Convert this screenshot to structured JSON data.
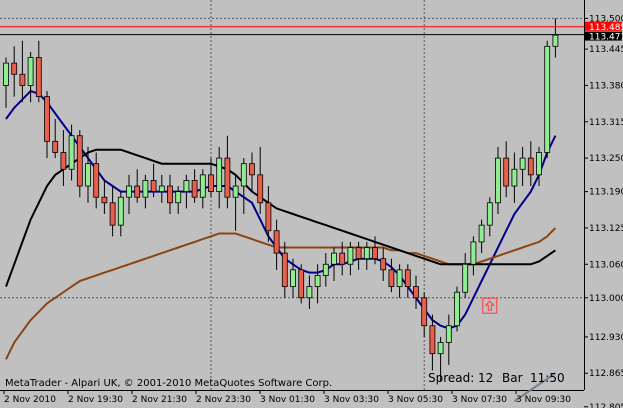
{
  "window": {
    "watermark": "MetaTrader - Alpari UK, © 2001-2010 MetaQuotes Software Corp.",
    "spread_label": "Spread:",
    "spread_value": "12",
    "bar_label": "Bar",
    "bar_timer": "11:50"
  },
  "colors": {
    "background": "#c0c0c0",
    "bull_candle": "#90ee90",
    "bear_candle": "#e8604c",
    "candle_outline": "#000000",
    "ma_fast": "#00008b",
    "ma_medium": "#8b4513",
    "ma_slow": "#000000",
    "ma_far": "#708090",
    "ask_line": "#ff0000",
    "bid_line": "#000000",
    "signal_arrow": "#ff3b3b"
  },
  "chart_data": {
    "type": "candlestick",
    "symbol_timeframe": "",
    "ylim": [
      112.835,
      113.515
    ],
    "x_ticks": [
      "2 Nov 2010",
      "2 Nov 19:30",
      "2 Nov 21:30",
      "2 Nov 23:30",
      "3 Nov 01:30",
      "3 Nov 03:30",
      "3 Nov 05:30",
      "3 Nov 07:30",
      "3 Nov 09:30"
    ],
    "y_ticks": [
      "113.500",
      "113.471",
      "113.445",
      "113.380",
      "113.315",
      "113.250",
      "113.190",
      "113.125",
      "113.060",
      "113.000",
      "112.930",
      "112.865",
      "112.805"
    ],
    "current_price_labels": {
      "ask": "113.485",
      "bid": "113.471"
    },
    "ask_price": 113.485,
    "bid_price": 113.471,
    "high_level": 113.5,
    "horizontal_level": 113.0,
    "vertical_lines_at_index": [
      25,
      51
    ],
    "candles": [
      {
        "o": 113.38,
        "h": 113.43,
        "l": 113.34,
        "c": 113.42
      },
      {
        "o": 113.42,
        "h": 113.45,
        "l": 113.36,
        "c": 113.4
      },
      {
        "o": 113.4,
        "h": 113.46,
        "l": 113.35,
        "c": 113.38
      },
      {
        "o": 113.38,
        "h": 113.44,
        "l": 113.35,
        "c": 113.43
      },
      {
        "o": 113.43,
        "h": 113.46,
        "l": 113.35,
        "c": 113.36
      },
      {
        "o": 113.36,
        "h": 113.37,
        "l": 113.25,
        "c": 113.28
      },
      {
        "o": 113.28,
        "h": 113.32,
        "l": 113.25,
        "c": 113.26
      },
      {
        "o": 113.26,
        "h": 113.3,
        "l": 113.2,
        "c": 113.23
      },
      {
        "o": 113.23,
        "h": 113.31,
        "l": 113.21,
        "c": 113.29
      },
      {
        "o": 113.29,
        "h": 113.3,
        "l": 113.18,
        "c": 113.2
      },
      {
        "o": 113.2,
        "h": 113.27,
        "l": 113.17,
        "c": 113.24
      },
      {
        "o": 113.24,
        "h": 113.26,
        "l": 113.16,
        "c": 113.18
      },
      {
        "o": 113.18,
        "h": 113.21,
        "l": 113.15,
        "c": 113.17
      },
      {
        "o": 113.17,
        "h": 113.2,
        "l": 113.11,
        "c": 113.13
      },
      {
        "o": 113.13,
        "h": 113.19,
        "l": 113.11,
        "c": 113.18
      },
      {
        "o": 113.18,
        "h": 113.22,
        "l": 113.15,
        "c": 113.2
      },
      {
        "o": 113.2,
        "h": 113.23,
        "l": 113.17,
        "c": 113.18
      },
      {
        "o": 113.18,
        "h": 113.22,
        "l": 113.16,
        "c": 113.21
      },
      {
        "o": 113.21,
        "h": 113.24,
        "l": 113.18,
        "c": 113.19
      },
      {
        "o": 113.19,
        "h": 113.22,
        "l": 113.17,
        "c": 113.2
      },
      {
        "o": 113.2,
        "h": 113.22,
        "l": 113.15,
        "c": 113.17
      },
      {
        "o": 113.17,
        "h": 113.2,
        "l": 113.15,
        "c": 113.19
      },
      {
        "o": 113.19,
        "h": 113.22,
        "l": 113.16,
        "c": 113.21
      },
      {
        "o": 113.21,
        "h": 113.23,
        "l": 113.17,
        "c": 113.18
      },
      {
        "o": 113.18,
        "h": 113.23,
        "l": 113.16,
        "c": 113.22
      },
      {
        "o": 113.22,
        "h": 113.25,
        "l": 113.18,
        "c": 113.19
      },
      {
        "o": 113.19,
        "h": 113.27,
        "l": 113.16,
        "c": 113.25
      },
      {
        "o": 113.25,
        "h": 113.29,
        "l": 113.16,
        "c": 113.18
      },
      {
        "o": 113.18,
        "h": 113.22,
        "l": 113.12,
        "c": 113.2
      },
      {
        "o": 113.2,
        "h": 113.25,
        "l": 113.15,
        "c": 113.24
      },
      {
        "o": 113.24,
        "h": 113.26,
        "l": 113.19,
        "c": 113.22
      },
      {
        "o": 113.22,
        "h": 113.27,
        "l": 113.15,
        "c": 113.17
      },
      {
        "o": 113.17,
        "h": 113.2,
        "l": 113.1,
        "c": 113.12
      },
      {
        "o": 113.12,
        "h": 113.14,
        "l": 113.05,
        "c": 113.08
      },
      {
        "o": 113.08,
        "h": 113.1,
        "l": 113.0,
        "c": 113.02
      },
      {
        "o": 113.02,
        "h": 113.07,
        "l": 113.0,
        "c": 113.05
      },
      {
        "o": 113.05,
        "h": 113.06,
        "l": 112.99,
        "c": 113.0
      },
      {
        "o": 113.0,
        "h": 113.04,
        "l": 112.98,
        "c": 113.02
      },
      {
        "o": 113.02,
        "h": 113.06,
        "l": 112.99,
        "c": 113.04
      },
      {
        "o": 113.04,
        "h": 113.08,
        "l": 113.02,
        "c": 113.06
      },
      {
        "o": 113.06,
        "h": 113.09,
        "l": 113.03,
        "c": 113.08
      },
      {
        "o": 113.08,
        "h": 113.1,
        "l": 113.04,
        "c": 113.06
      },
      {
        "o": 113.06,
        "h": 113.1,
        "l": 113.04,
        "c": 113.09
      },
      {
        "o": 113.09,
        "h": 113.1,
        "l": 113.05,
        "c": 113.07
      },
      {
        "o": 113.07,
        "h": 113.1,
        "l": 113.05,
        "c": 113.09
      },
      {
        "o": 113.09,
        "h": 113.11,
        "l": 113.06,
        "c": 113.07
      },
      {
        "o": 113.07,
        "h": 113.09,
        "l": 113.03,
        "c": 113.05
      },
      {
        "o": 113.05,
        "h": 113.07,
        "l": 113.01,
        "c": 113.02
      },
      {
        "o": 113.02,
        "h": 113.06,
        "l": 113.0,
        "c": 113.05
      },
      {
        "o": 113.05,
        "h": 113.06,
        "l": 113.0,
        "c": 113.02
      },
      {
        "o": 113.02,
        "h": 113.04,
        "l": 112.98,
        "c": 113.0
      },
      {
        "o": 113.0,
        "h": 113.01,
        "l": 112.93,
        "c": 112.95
      },
      {
        "o": 112.95,
        "h": 112.97,
        "l": 112.87,
        "c": 112.9
      },
      {
        "o": 112.9,
        "h": 112.93,
        "l": 112.85,
        "c": 112.92
      },
      {
        "o": 112.92,
        "h": 112.97,
        "l": 112.88,
        "c": 112.95
      },
      {
        "o": 112.95,
        "h": 113.02,
        "l": 112.94,
        "c": 113.01
      },
      {
        "o": 113.01,
        "h": 113.08,
        "l": 113.0,
        "c": 113.06
      },
      {
        "o": 113.06,
        "h": 113.11,
        "l": 113.04,
        "c": 113.1
      },
      {
        "o": 113.1,
        "h": 113.14,
        "l": 113.08,
        "c": 113.13
      },
      {
        "o": 113.13,
        "h": 113.18,
        "l": 113.11,
        "c": 113.17
      },
      {
        "o": 113.17,
        "h": 113.27,
        "l": 113.15,
        "c": 113.25
      },
      {
        "o": 113.25,
        "h": 113.28,
        "l": 113.18,
        "c": 113.2
      },
      {
        "o": 113.2,
        "h": 113.26,
        "l": 113.17,
        "c": 113.23
      },
      {
        "o": 113.23,
        "h": 113.27,
        "l": 113.2,
        "c": 113.25
      },
      {
        "o": 113.25,
        "h": 113.28,
        "l": 113.2,
        "c": 113.22
      },
      {
        "o": 113.22,
        "h": 113.27,
        "l": 113.2,
        "c": 113.26
      },
      {
        "o": 113.26,
        "h": 113.46,
        "l": 113.25,
        "c": 113.45
      },
      {
        "o": 113.45,
        "h": 113.5,
        "l": 113.43,
        "c": 113.47
      }
    ],
    "series": [
      {
        "color": "#00008b",
        "values": [
          113.32,
          113.34,
          113.355,
          113.37,
          113.365,
          113.35,
          113.33,
          113.31,
          113.29,
          113.27,
          113.25,
          113.23,
          113.21,
          113.2,
          113.19,
          113.19,
          113.19,
          113.19,
          113.19,
          113.19,
          113.19,
          113.19,
          113.19,
          113.19,
          113.195,
          113.2,
          113.2,
          113.2,
          113.19,
          113.18,
          113.17,
          113.14,
          113.11,
          113.09,
          113.07,
          113.06,
          113.05,
          113.045,
          113.045,
          113.05,
          113.06,
          113.06,
          113.065,
          113.07,
          113.07,
          113.07,
          113.065,
          113.055,
          113.04,
          113.02,
          113.0,
          112.98,
          112.96,
          112.95,
          112.945,
          112.95,
          112.97,
          113.0,
          113.03,
          113.06,
          113.09,
          113.12,
          113.15,
          113.17,
          113.19,
          113.22,
          113.26,
          113.29
        ]
      },
      {
        "color": "#8b4513",
        "values": [
          112.89,
          112.92,
          112.94,
          112.96,
          112.975,
          112.99,
          113.0,
          113.01,
          113.02,
          113.03,
          113.035,
          113.04,
          113.045,
          113.05,
          113.055,
          113.06,
          113.065,
          113.07,
          113.075,
          113.08,
          113.085,
          113.09,
          113.095,
          113.1,
          113.105,
          113.11,
          113.115,
          113.115,
          113.115,
          113.11,
          113.105,
          113.1,
          113.095,
          113.09,
          113.09,
          113.09,
          113.09,
          113.09,
          113.09,
          113.09,
          113.09,
          113.09,
          113.09,
          113.09,
          113.09,
          113.09,
          113.09,
          113.085,
          113.085,
          113.08,
          113.08,
          113.075,
          113.07,
          113.065,
          113.06,
          113.06,
          113.06,
          113.06,
          113.065,
          113.07,
          113.075,
          113.08,
          113.085,
          113.09,
          113.095,
          113.1,
          113.11,
          113.125
        ]
      },
      {
        "color": "#000000",
        "values": [
          113.02,
          113.06,
          113.1,
          113.14,
          113.17,
          113.2,
          113.22,
          113.23,
          113.24,
          113.25,
          113.26,
          113.265,
          113.265,
          113.265,
          113.265,
          113.26,
          113.255,
          113.25,
          113.245,
          113.24,
          113.24,
          113.24,
          113.24,
          113.24,
          113.24,
          113.24,
          113.235,
          113.23,
          113.22,
          113.205,
          113.19,
          113.18,
          113.17,
          113.16,
          113.155,
          113.15,
          113.145,
          113.14,
          113.135,
          113.13,
          113.125,
          113.12,
          113.115,
          113.11,
          113.105,
          113.1,
          113.095,
          113.09,
          113.085,
          113.08,
          113.075,
          113.07,
          113.065,
          113.06,
          113.06,
          113.06,
          113.06,
          113.06,
          113.06,
          113.06,
          113.06,
          113.06,
          113.06,
          113.06,
          113.06,
          113.065,
          113.075,
          113.085
        ]
      },
      {
        "color": "#708090",
        "values": [
          null,
          null,
          null,
          null,
          null,
          null,
          null,
          null,
          null,
          null,
          null,
          null,
          null,
          null,
          null,
          null,
          null,
          null,
          null,
          null,
          null,
          null,
          null,
          null,
          null,
          null,
          null,
          null,
          null,
          null,
          null,
          null,
          null,
          null,
          null,
          null,
          null,
          null,
          null,
          null,
          null,
          null,
          null,
          null,
          null,
          null,
          null,
          null,
          null,
          null,
          null,
          null,
          null,
          null,
          null,
          null,
          null,
          null,
          null,
          null,
          null,
          null,
          112.815,
          112.825,
          112.835,
          112.845,
          112.855,
          112.865
        ]
      }
    ],
    "arrow_signal": {
      "index": 59,
      "price": 112.985,
      "direction": "up"
    },
    "grid": false
  }
}
